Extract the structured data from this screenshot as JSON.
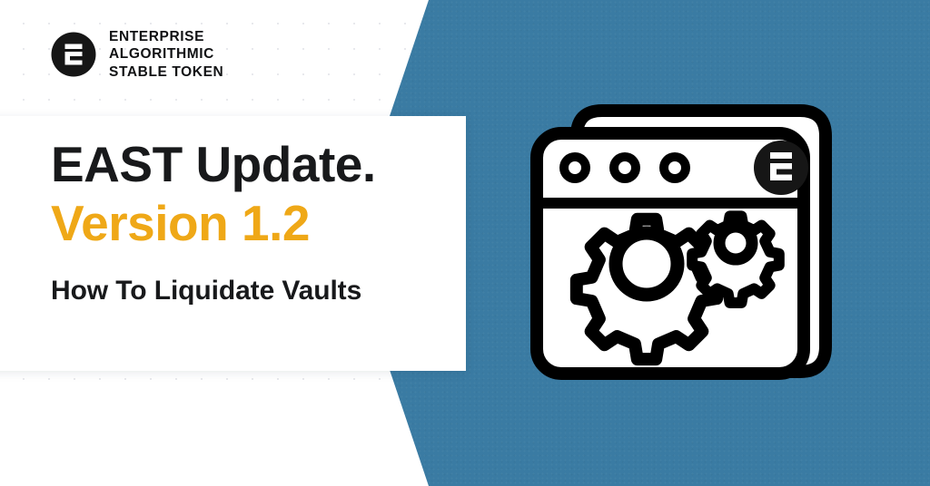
{
  "brand": {
    "logo_icon": "east-e-monogram-icon",
    "wordmark_lines": [
      "ENTERPRISE",
      "ALGORITHMIC",
      "STABLE TOKEN"
    ]
  },
  "headline": {
    "line1": "EAST Update.",
    "line2": "Version 1.2",
    "line3": "How To Liquidate Vaults"
  },
  "illustration": {
    "name": "browser-window-gears-illustration",
    "window_dots_count": 3,
    "window_logo_icon": "east-e-monogram-icon",
    "gears": [
      {
        "name": "large-gear-icon",
        "teeth": 8
      },
      {
        "name": "small-gear-icon",
        "teeth": 8
      }
    ]
  },
  "colors": {
    "accent_orange": "#EFA817",
    "background_blue": "#3A7BA3",
    "text_dark": "#18191B",
    "card_white": "#FFFFFF",
    "ink_black": "#000000"
  }
}
